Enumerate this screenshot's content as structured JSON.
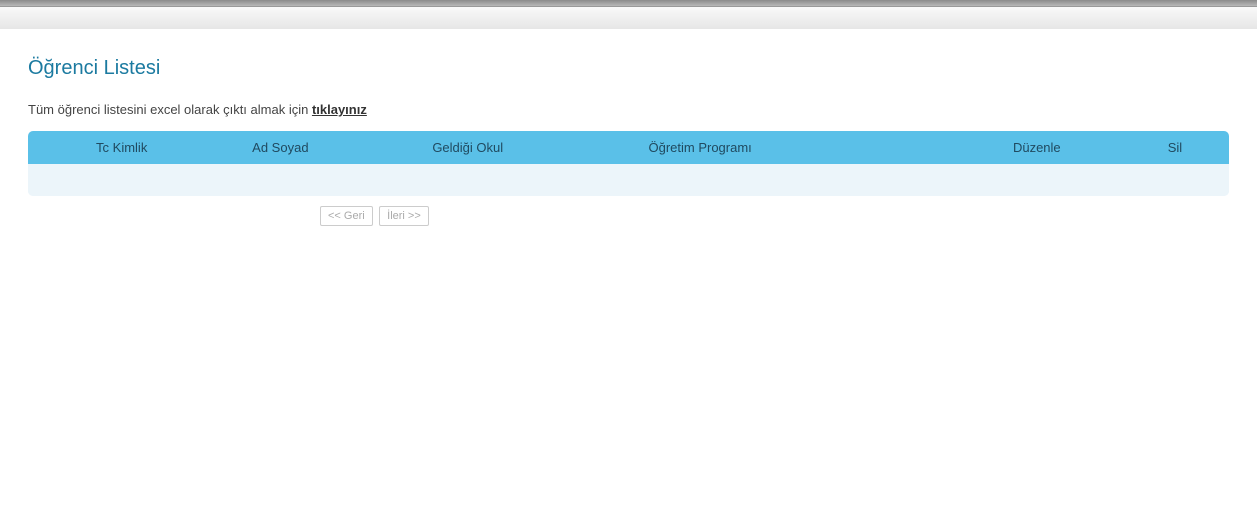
{
  "page": {
    "title": "Öğrenci Listesi",
    "subtitle_prefix": "Tüm öğrenci listesini excel olarak çıktı almak için ",
    "subtitle_link": "tıklayınız"
  },
  "table": {
    "headers": {
      "tc": "Tc Kimlik",
      "ad_soyad": "Ad Soyad",
      "geldigi_okul": "Geldiği Okul",
      "ogretim_programi": "Öğretim Programı",
      "duzenle": "Düzenle",
      "sil": "Sil"
    }
  },
  "pager": {
    "prev": "<< Geri",
    "next": "İleri >>"
  }
}
